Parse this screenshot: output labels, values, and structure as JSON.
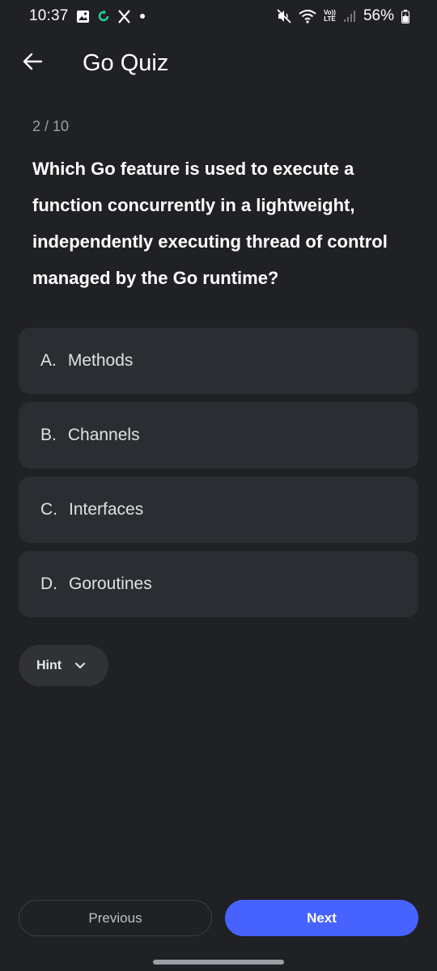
{
  "status_bar": {
    "time": "10:37",
    "battery": "56%",
    "lte_top": "Vo))",
    "lte_bottom": "LTE",
    "icons": [
      "gallery-icon",
      "sync-icon",
      "x-icon",
      "notification-dot",
      "mute-icon",
      "wifi-icon",
      "lte-icon",
      "signal-icon",
      "battery-charging-icon"
    ]
  },
  "app_bar": {
    "title": "Go Quiz",
    "back_icon": "arrow-back-icon"
  },
  "quiz": {
    "progress": "2 / 10",
    "question": "Which Go feature is used to execute a function concurrently in a lightweight, independently executing thread of control managed by the Go runtime?",
    "options": [
      {
        "letter": "A.",
        "text": "Methods"
      },
      {
        "letter": "B.",
        "text": "Channels"
      },
      {
        "letter": "C.",
        "text": "Interfaces"
      },
      {
        "letter": "D.",
        "text": "Goroutines"
      }
    ],
    "hint_label": "Hint",
    "previous_label": "Previous",
    "next_label": "Next"
  },
  "colors": {
    "background": "#202124",
    "option_bg": "#2a2d31",
    "accent": "#4763ff"
  }
}
